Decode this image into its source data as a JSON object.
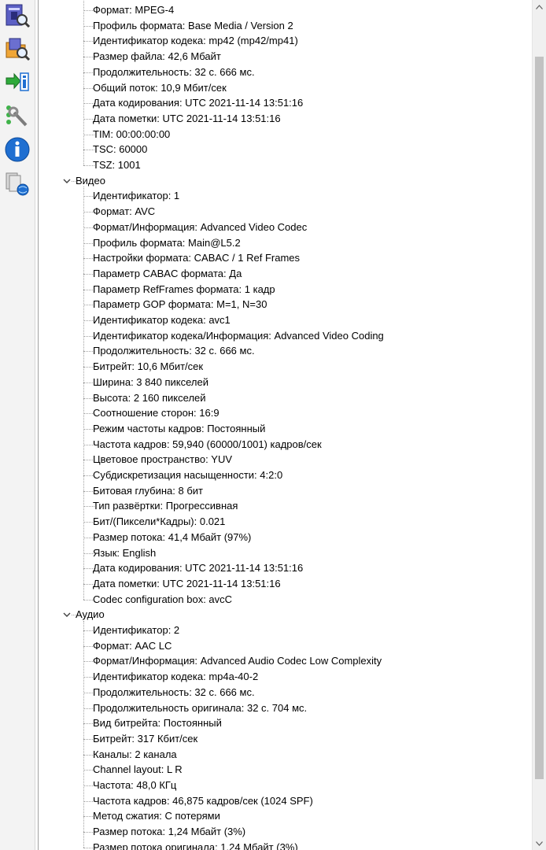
{
  "toolbar": [
    {
      "name": "open-file-icon"
    },
    {
      "name": "open-folder-icon"
    },
    {
      "name": "export-icon"
    },
    {
      "name": "preferences-icon"
    },
    {
      "name": "about-icon"
    },
    {
      "name": "knowledge-base-icon"
    }
  ],
  "general": [
    "Формат: MPEG-4",
    "Профиль формата: Base Media / Version 2",
    "Идентификатор кодека: mp42 (mp42/mp41)",
    "Размер файла: 42,6 Мбайт",
    "Продолжительность: 32 с. 666 мс.",
    "Общий поток: 10,9 Мбит/сек",
    "Дата кодирования: UTC 2021-11-14 13:51:16",
    "Дата пометки: UTC 2021-11-14 13:51:16",
    "TIM: 00:00:00:00",
    "TSC: 60000",
    "TSZ: 1001"
  ],
  "video": {
    "title": "Видео",
    "items": [
      "Идентификатор: 1",
      "Формат: AVC",
      "Формат/Информация: Advanced Video Codec",
      "Профиль формата: Main@L5.2",
      "Настройки формата: CABAC / 1 Ref Frames",
      "Параметр CABAC формата: Да",
      "Параметр RefFrames формата: 1 кадр",
      "Параметр GOP формата: M=1, N=30",
      "Идентификатор кодека: avc1",
      "Идентификатор кодека/Информация: Advanced Video Coding",
      "Продолжительность: 32 с. 666 мс.",
      "Битрейт: 10,6 Мбит/сек",
      "Ширина: 3 840 пикселей",
      "Высота: 2 160 пикселей",
      "Соотношение сторон: 16:9",
      "Режим частоты кадров: Постоянный",
      "Частота кадров: 59,940 (60000/1001) кадров/сек",
      "Цветовое пространство: YUV",
      "Субдискретизация насыщенности: 4:2:0",
      "Битовая глубина: 8 бит",
      "Тип развёртки: Прогрессивная",
      "Бит/(Пиксели*Кадры): 0.021",
      "Размер потока: 41,4 Мбайт (97%)",
      "Язык: English",
      "Дата кодирования: UTC 2021-11-14 13:51:16",
      "Дата пометки: UTC 2021-11-14 13:51:16",
      "Codec configuration box: avcC"
    ]
  },
  "audio": {
    "title": "Аудио",
    "items": [
      "Идентификатор: 2",
      "Формат: AAC LC",
      "Формат/Информация: Advanced Audio Codec Low Complexity",
      "Идентификатор кодека: mp4a-40-2",
      "Продолжительность: 32 с. 666 мс.",
      "Продолжительность оригинала: 32 с. 704 мс.",
      "Вид битрейта: Постоянный",
      "Битрейт: 317 Кбит/сек",
      "Каналы: 2 канала",
      "Channel layout: L R",
      "Частота: 48,0 КГц",
      "Частота кадров: 46,875 кадров/сек (1024 SPF)",
      "Метод сжатия: С потерями",
      "Размер потока: 1,24 Мбайт (3%)",
      "Размер потока оригинала: 1,24 Мбайт (3%)"
    ]
  },
  "colors": {
    "accent_blue": "#1f6fd1",
    "tree_line": "#a0a0a0",
    "scroll_thumb": "#c2c2c2"
  }
}
